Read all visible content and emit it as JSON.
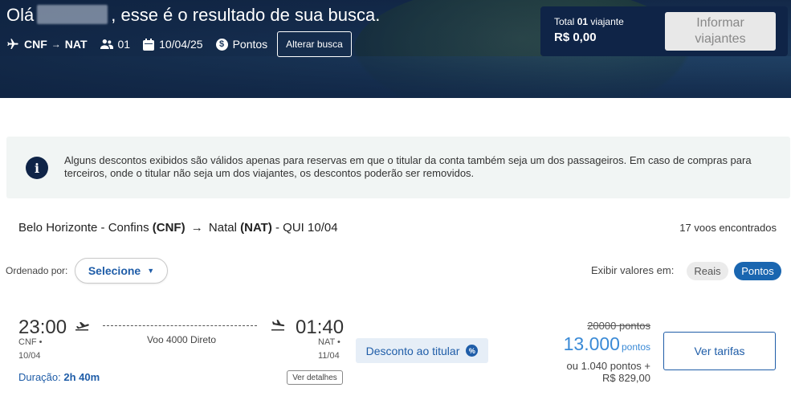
{
  "header": {
    "greeting_prefix": "Olá",
    "greeting_suffix": ", esse é o resultado de sua busca.",
    "origin": "CNF",
    "destination": "NAT",
    "passengers": "01",
    "date": "10/04/25",
    "fare_type": "Pontos",
    "change_search_label": "Alterar busca"
  },
  "total": {
    "label_prefix": "Total",
    "count": "01",
    "label_suffix": "viajante",
    "amount": "R$ 0,00",
    "inform_button_line1": "Informar",
    "inform_button_line2": "viajantes"
  },
  "notice": {
    "icon": "info-icon",
    "text": "Alguns descontos exibidos são válidos apenas para reservas em que o titular da conta também seja um dos passageiros. Em caso de compras para terceiros, onde o titular não seja um dos viajantes, os descontos poderão ser removidos."
  },
  "route": {
    "origin_city": "Belo Horizonte - Confins",
    "origin_code": "(CNF)",
    "dest_city": "Natal",
    "dest_code": "(NAT)",
    "date_text": "- QUI 10/04",
    "flights_found": "17 voos encontrados"
  },
  "sort": {
    "label": "Ordenado por:",
    "selected": "Selecione",
    "display_label": "Exibir valores em:",
    "option_money": "Reais",
    "option_points": "Pontos",
    "active": "Pontos"
  },
  "flight": {
    "departure_time": "23:00",
    "departure_code": "CNF •",
    "departure_date": "10/04",
    "arrival_time": "01:40",
    "arrival_code": "NAT •",
    "arrival_date": "11/04",
    "flight_info": "Voo 4000 Direto",
    "duration_label": "Duração:",
    "duration_value": "2h 40m",
    "details_label": "Ver detalhes",
    "discount_label": "Desconto ao titular",
    "old_price": "20000 pontos",
    "new_price_number": "13.000",
    "new_price_unit": "pontos",
    "alt_price_line1": "ou 1.040 pontos +",
    "alt_price_line2": "R$ 829,00",
    "fares_button": "Ver tarifas"
  },
  "colors": {
    "brand_dark": "#0f2447",
    "link_blue": "#1f5da8",
    "active_pill": "#1a66b0"
  }
}
